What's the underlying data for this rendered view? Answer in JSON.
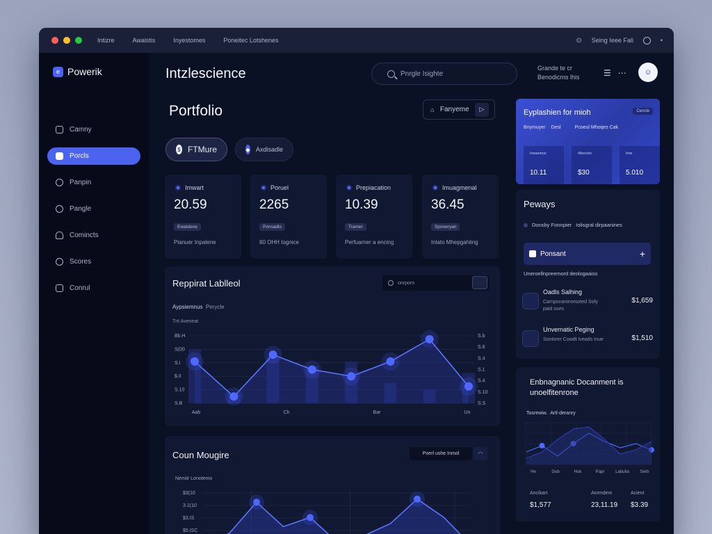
{
  "window": {
    "menu": [
      "Intizre",
      "Awaistis",
      "Inyestomes",
      "Poneitec Lotshenes"
    ],
    "status_text": "Seing Ieee Fali",
    "dot_colors": [
      "#ff5f57",
      "#febc2e",
      "#28c840"
    ]
  },
  "sidebar": {
    "brand": "Powerik",
    "items": [
      {
        "label": "Camny",
        "icon": "home-icon",
        "active": false
      },
      {
        "label": "Porcls",
        "icon": "users-icon",
        "active": true
      },
      {
        "label": "Panpin",
        "icon": "link-icon",
        "active": false
      },
      {
        "label": "Pangle",
        "icon": "globe-icon",
        "active": false
      },
      {
        "label": "Comincts",
        "icon": "bell-icon",
        "active": false
      },
      {
        "label": "Scores",
        "icon": "target-icon",
        "active": false
      },
      {
        "label": "Conrul",
        "icon": "chat-icon",
        "active": false
      }
    ]
  },
  "header": {
    "title": "Intzlescience",
    "search_placeholder": "Pnrgle Isighte",
    "note_line1": "Grande te cr",
    "note_line2": "Benodicms lhis",
    "avatar_text": "☺"
  },
  "page": {
    "title": "Portfolio",
    "fav_button": "Fanyeme",
    "pill_primary": "FTMure",
    "pill_secondary": "Axdisadle"
  },
  "stats": [
    {
      "label": "Imwart",
      "value": "20.59",
      "badge": "Ewatdene",
      "foot": "Pianuer Inpalene"
    },
    {
      "label": "Poruel",
      "value": "2265",
      "badge": "Ponsadlo",
      "foot": "80 OHH Iognice"
    },
    {
      "label": "Prepiacation",
      "value": "10.39",
      "badge": "Tramer",
      "foot": "Perfuarner a encing"
    },
    {
      "label": "Imuagmenal",
      "value": "36.45",
      "badge": "Sponeryan",
      "foot": "Inlato Mhepgahiing"
    }
  ],
  "chart1": {
    "title": "Reppirat Lablleol",
    "search_placeholder": "onrporo",
    "sub_a": "Aypsiemnus",
    "sub_b": "Perycle",
    "sub2": "Tnt Aveneat"
  },
  "chart2": {
    "title": "Coun Mougire",
    "button": "Poerl ushe Inmol",
    "sub": "Nemiir Lonotemo"
  },
  "promo": {
    "title": "Eyplashien for mioh",
    "tag": "Cencle",
    "sub_a": "Bnymuyer",
    "sub_b": "Desl",
    "sub_c": "Pcoeul Mhoqes Cak",
    "cols": [
      {
        "label": "Inewonce",
        "value": "10.11"
      },
      {
        "label": "Weoctio",
        "value": "$30"
      },
      {
        "label": "Inre",
        "value": "5.010"
      }
    ]
  },
  "pays": {
    "title": "Peways",
    "note_a": "Donsby Fonnpier",
    "note_b": "Iolisgral dirpaanines",
    "bar_label": "Ponsant",
    "bar_plus": "+",
    "caption": "Uneroellnpreemord deologaaiss",
    "rows": [
      {
        "name": "Oadls Salhing",
        "desc": "Carnpsnaninorsoted Sofy paid sues",
        "amount": "$1,659"
      },
      {
        "name": "Unvernatic Peging",
        "desc": "Sontorer Cowdt Iveads Inue",
        "amount": "$1,510"
      }
    ]
  },
  "doc": {
    "title_line1": "Enbnagnanic Docanment is",
    "title_line2": "unoelfitenrone",
    "legend_a": "Tosrewiw.",
    "legend_b": "Artl-deranry",
    "footer": [
      {
        "label": "Ancikart",
        "value": "$1,577"
      },
      {
        "label": "Anrmdem",
        "value": "23,11.19"
      },
      {
        "label": "Acient",
        "value": "$3.39"
      }
    ]
  },
  "chart_data": [
    {
      "type": "line",
      "title": "Reppirat Lablleol",
      "x": [
        "Aab",
        "Ch",
        "Bar",
        "Un"
      ],
      "y_left_ticks": [
        "Bb.H",
        "S(00",
        "S.I",
        "$.II",
        "S.10",
        "S.B"
      ],
      "y_right_ticks": [
        "S.b",
        "S.6",
        "S.4",
        "S.1",
        "S.4",
        "S.10",
        "S.S"
      ],
      "series": [
        {
          "values": [
            0.62,
            0.1,
            0.72,
            0.5,
            0.4,
            0.62,
            0.95,
            0.25
          ]
        }
      ],
      "bars": [
        0.8,
        0.15,
        0.7,
        0.55,
        0.62,
        0.3,
        0.2,
        0.45
      ],
      "grid": true
    },
    {
      "type": "line",
      "title": "Coun Mougire",
      "y_left_ticks": [
        "$3(10",
        "3.1(10",
        "$3.IS",
        "$5.ISC"
      ],
      "series": [
        {
          "values": [
            0.1,
            0.35,
            0.85,
            0.45,
            0.6,
            0.2,
            0.3,
            0.5,
            0.9,
            0.6,
            0.15
          ]
        }
      ],
      "grid": true
    },
    {
      "type": "line",
      "title": "",
      "x": [
        "He",
        "Gub",
        "Huk",
        "Papr",
        "Labutia",
        "Serb"
      ],
      "series": [
        {
          "values": [
            0.3,
            0.45,
            0.2,
            0.5,
            0.75,
            0.55,
            0.4,
            0.5,
            0.35
          ]
        },
        {
          "values": [
            0.15,
            0.3,
            0.6,
            0.85,
            0.9,
            0.6,
            0.25,
            0.35,
            0.55
          ]
        }
      ]
    }
  ]
}
